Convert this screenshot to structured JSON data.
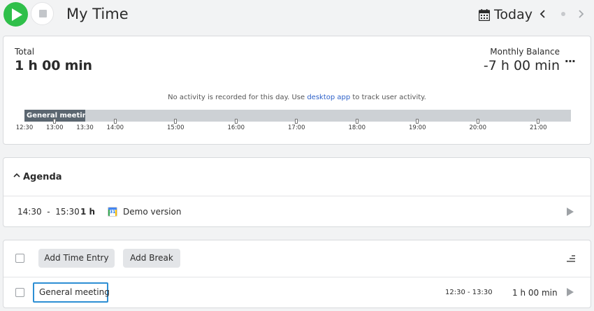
{
  "header": {
    "title": "My Time",
    "date_label": "Today",
    "prev_icon": "chevron-left-icon",
    "next_icon": "chevron-right-icon",
    "colors": {
      "play": "#2fbf4a",
      "stop": "#c3c6ca"
    }
  },
  "summary": {
    "total_label": "Total",
    "total_value": "1 h 00 min",
    "balance_label": "Monthly Balance",
    "balance_value": "-7 h 00 min",
    "more_label": "···",
    "note_before": "No activity is recorded for this day. Use ",
    "note_link": "desktop app",
    "note_after": " to track user activity."
  },
  "timeline": {
    "segment_label": "General meeting",
    "segment_label_fade": "g",
    "segment_start": "12:30",
    "segment_end": "13:30",
    "start_label": "12:30",
    "hour_labels": [
      "13:00",
      "13:30",
      "14:00",
      "15:00",
      "16:00",
      "17:00",
      "18:00",
      "19:00",
      "20:00",
      "21:00"
    ]
  },
  "agenda": {
    "title": "Agenda",
    "items": [
      {
        "start": "14:30",
        "separator": "-",
        "end": "15:30",
        "duration": "1 h",
        "calendar_badge": "31",
        "name": "Demo version"
      }
    ]
  },
  "entries": {
    "add_entry_label": "Add Time Entry",
    "add_break_label": "Add Break",
    "rows": [
      {
        "name": "General meeting",
        "span": "12:30 - 13:30",
        "duration": "1 h 00 min"
      }
    ]
  }
}
